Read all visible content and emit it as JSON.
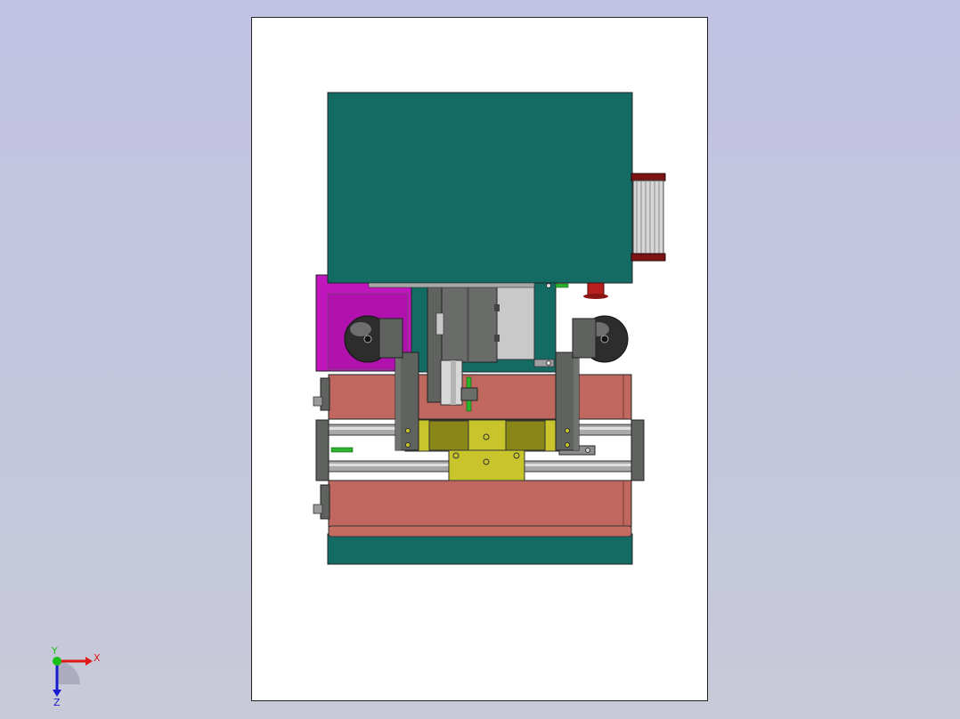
{
  "viewport": {
    "name": "graphics-area"
  },
  "triad": {
    "x_label": "X",
    "y_label": "Y",
    "z_label": "Z"
  },
  "colors": {
    "background_top": "#c2c2e2",
    "sheet": "#ffffff",
    "motor_teal": "#136b64",
    "base_teal": "#136b64",
    "salmon_plate": "#c0685f",
    "magenta_block": "#c115bd",
    "yellow_block": "#c9c42b",
    "olive_block": "#8a8617",
    "dark_gray": "#5f625f",
    "light_gray": "#c8c8c8",
    "dark_red": "#7a1414",
    "triad_red": "#e01818",
    "triad_blue": "#1a1ad0",
    "triad_green": "#18c018"
  }
}
